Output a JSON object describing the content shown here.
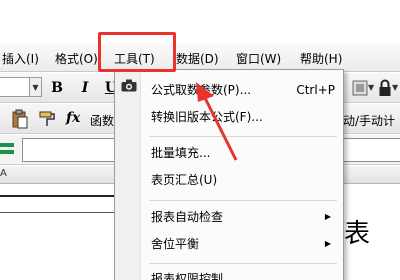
{
  "menubar": {
    "items": [
      {
        "label": "插入(I)"
      },
      {
        "label": "格式(O)"
      },
      {
        "label": "工具(T)"
      },
      {
        "label": "数据(D)"
      },
      {
        "label": "窗口(W)"
      },
      {
        "label": "帮助(H)"
      }
    ]
  },
  "toolbar1": {
    "bold": "B",
    "italic": "I",
    "underline": "U"
  },
  "toolbar2": {
    "fx": "fx",
    "function_label": "函数",
    "auto_manual_label": "动/手动计"
  },
  "sheet": {
    "column_header": "A",
    "title_char": "表"
  },
  "tools_menu": {
    "items": [
      {
        "label": "公式取数参数(P)...",
        "shortcut": "Ctrl+P"
      },
      {
        "label": "转换旧版本公式(F)..."
      },
      {
        "label": "批量填充..."
      },
      {
        "label": "表页汇总(U)"
      },
      {
        "label": "报表自动检查",
        "submenu": "▶"
      },
      {
        "label": "舍位平衡",
        "submenu": "▶"
      },
      {
        "label": "报表权限控制..."
      }
    ]
  },
  "colors": {
    "highlight": "#e8332f",
    "accent_green": "#1f8f4a"
  }
}
